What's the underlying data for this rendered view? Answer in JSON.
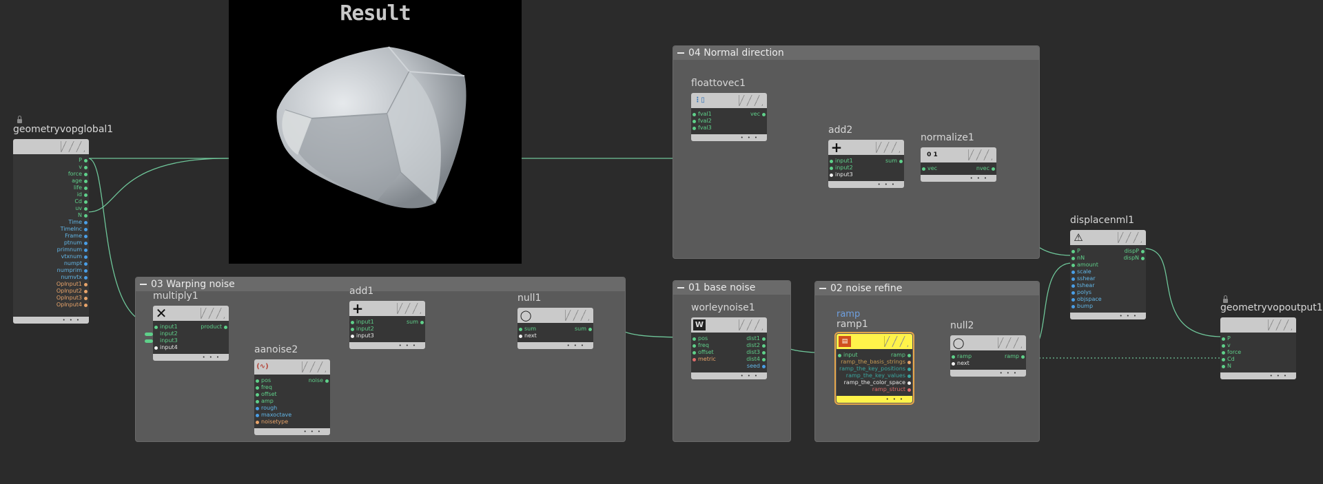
{
  "result_title": "Result",
  "boxes": {
    "normal": "04 Normal direction",
    "warping": "03 Warping noise",
    "base": "01 base noise",
    "refine": "02 noise refine"
  },
  "nodes": {
    "geoglobal": {
      "title": "geometryvopglobal1",
      "outputs": [
        "P",
        "v",
        "force",
        "age",
        "life",
        "id",
        "Cd",
        "uv",
        "N",
        "Time",
        "TimeInc",
        "Frame",
        "ptnum",
        "primnum",
        "vtxnum",
        "numpt",
        "numprim",
        "numvtx",
        "OpInput1",
        "OpInput2",
        "OpInput3",
        "OpInput4"
      ]
    },
    "floattovec": {
      "title": "floattovec1",
      "inputs": [
        "fval1",
        "fval2",
        "fval3"
      ],
      "output": "vec"
    },
    "add2": {
      "title": "add2",
      "inputs": [
        "input1",
        "input2",
        "input3"
      ],
      "output": "sum"
    },
    "normalize": {
      "title": "normalize1",
      "input": "vec",
      "output": "nvec",
      "icon": "0 1"
    },
    "displace": {
      "title": "displacenml1",
      "inputs": [
        "P",
        "nN",
        "amount",
        "scale",
        "sshear",
        "tshear",
        "polys",
        "objspace",
        "bump"
      ],
      "outputs": [
        "dispP",
        "dispN"
      ]
    },
    "geoout": {
      "title": "geometryvopoutput1",
      "inputs": [
        "P",
        "v",
        "force",
        "Cd",
        "N"
      ]
    },
    "multiply": {
      "title": "multiply1",
      "inputs": [
        "input1",
        "input2",
        "input3",
        "input4"
      ],
      "output": "product"
    },
    "aanoise": {
      "title": "aanoise2",
      "inputs": [
        "pos",
        "freq",
        "offset",
        "amp",
        "rough",
        "maxoctave",
        "noisetype"
      ],
      "output": "noise"
    },
    "add1": {
      "title": "add1",
      "inputs": [
        "input1",
        "input2",
        "input3"
      ],
      "output": "sum"
    },
    "null1": {
      "title": "null1",
      "inputs": [
        "sum",
        "next"
      ],
      "output": "sum"
    },
    "worley": {
      "title": "worleynoise1",
      "inputs": [
        "pos",
        "freq",
        "offset",
        "metric"
      ],
      "outputs": [
        "dist1",
        "dist2",
        "dist3",
        "dist4",
        "seed"
      ]
    },
    "ramp1": {
      "subtitle": "ramp",
      "title": "ramp1",
      "input": "input",
      "output": "ramp",
      "params": [
        "ramp_the_basis_strings",
        "ramp_the_key_positions",
        "ramp_the_key_values",
        "ramp_the_color_space",
        "ramp_struct"
      ]
    },
    "null2": {
      "title": "null2",
      "inputs": [
        "ramp",
        "next"
      ],
      "output": "ramp"
    }
  },
  "colors": {
    "background": "#2b2b2b",
    "netbox": "#5a5a5a",
    "wire": "#5fd08a",
    "ramp_highlight": "#fff34a"
  }
}
